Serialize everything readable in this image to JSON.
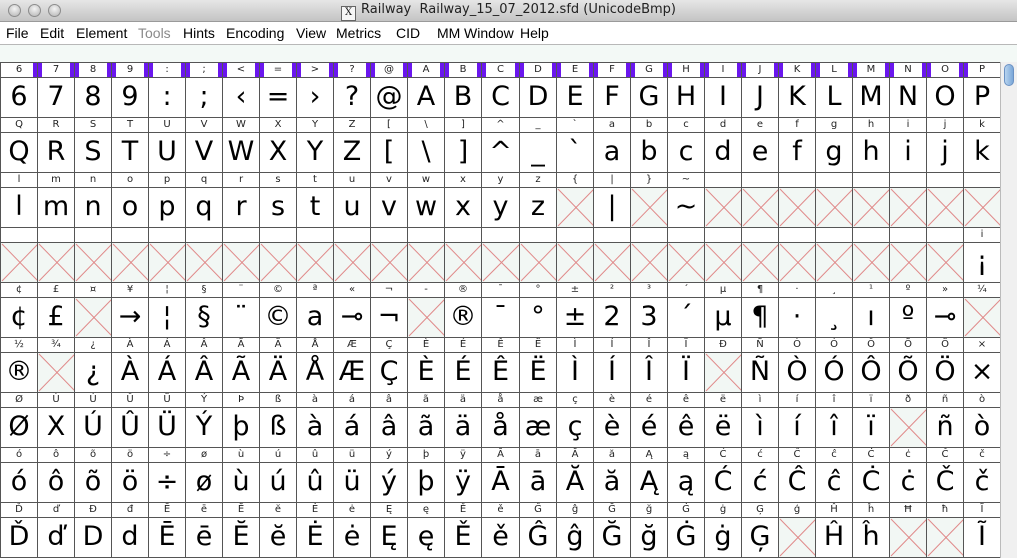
{
  "window": {
    "title_app": "Railway",
    "title_file": "Railway_15_07_2012.sfd (UnicodeBmp)",
    "x_glyph": "X"
  },
  "menu": [
    {
      "label": "File",
      "u": "F",
      "rest": "ile",
      "disabled": false
    },
    {
      "label": "Edit",
      "u": "E",
      "rest": "dit",
      "disabled": false
    },
    {
      "label": "Element",
      "u": "E",
      "rest": "lement",
      "disabled": false
    },
    {
      "label": "Tools",
      "u": "T",
      "rest": "ools",
      "disabled": true
    },
    {
      "label": "Hints",
      "u": "i",
      "pre": "H",
      "rest": "nts",
      "disabled": false
    },
    {
      "label": "Encoding",
      "u": "E",
      "rest": "ncoding",
      "disabled": false
    },
    {
      "label": "View",
      "u": "V",
      "rest": "iew",
      "disabled": false
    },
    {
      "label": "Metrics",
      "u": "M",
      "rest": "etrics",
      "disabled": false
    },
    {
      "label": "CID",
      "u": "C",
      "rest": "ID",
      "disabled": false
    },
    {
      "label": "MM",
      "u": "",
      "rest": "MM",
      "disabled": false
    },
    {
      "label": "Window",
      "u": "W",
      "rest": "indow",
      "disabled": false
    },
    {
      "label": "Help",
      "u": "H",
      "rest": "elp",
      "disabled": false
    }
  ],
  "colors": {
    "selected": "#6a16ee",
    "empty_cross": "#e08a8a",
    "cell_border": "#555555",
    "background": "#f3f9f6"
  },
  "grid": {
    "columns": 27,
    "rows": [
      {
        "labels": [
          "6",
          "7",
          "8",
          "9",
          ":",
          ";",
          "<",
          "=",
          ">",
          "?",
          "@",
          "A",
          "B",
          "C",
          "D",
          "E",
          "F",
          "G",
          "H",
          "I",
          "J",
          "K",
          "L",
          "M",
          "N",
          "O",
          "P"
        ],
        "glyphs": [
          "6",
          "7",
          "8",
          "9",
          ":",
          ";",
          "‹",
          "=",
          "›",
          "?",
          "@",
          "A",
          "B",
          "C",
          "D",
          "E",
          "F",
          "G",
          "H",
          "I",
          "J",
          "K",
          "L",
          "M",
          "N",
          "O",
          "P"
        ]
      },
      {
        "labels": [
          "Q",
          "R",
          "S",
          "T",
          "U",
          "V",
          "W",
          "X",
          "Y",
          "Z",
          "[",
          "\\",
          "]",
          "^",
          "_",
          "`",
          "a",
          "b",
          "c",
          "d",
          "e",
          "f",
          "g",
          "h",
          "i",
          "j",
          "k"
        ],
        "glyphs": [
          "Q",
          "R",
          "S",
          "T",
          "U",
          "V",
          "W",
          "X",
          "Y",
          "Z",
          "[",
          "\\",
          "]",
          "^",
          "_",
          "`",
          "a",
          "b",
          "c",
          "d",
          "e",
          "f",
          "g",
          "h",
          "i",
          "j",
          "k"
        ]
      },
      {
        "labels": [
          "l",
          "m",
          "n",
          "o",
          "p",
          "q",
          "r",
          "s",
          "t",
          "u",
          "v",
          "w",
          "x",
          "y",
          "z",
          "{",
          "|",
          "}",
          "~",
          "\u0000",
          "",
          "",
          "",
          "",
          "",
          "",
          ""
        ],
        "glyphs": [
          "l",
          "m",
          "n",
          "o",
          "p",
          "q",
          "r",
          "s",
          "t",
          "u",
          "v",
          "w",
          "x",
          "y",
          "z",
          "",
          "|",
          "",
          "~",
          "",
          "",
          "",
          "",
          "",
          "",
          "",
          ""
        ]
      },
      {
        "labels": [
          "",
          "",
          "",
          "",
          "",
          "",
          "",
          "",
          "",
          "",
          "",
          "",
          "",
          "",
          "",
          "",
          "",
          "",
          "",
          "",
          "",
          "",
          "",
          "",
          "",
          "",
          "i"
        ],
        "glyphs": [
          "",
          "",
          "",
          "",
          "",
          "",
          "",
          "",
          "",
          "",
          "",
          "",
          "",
          "",
          "",
          "",
          "",
          "",
          "",
          "",
          "",
          "",
          "",
          "",
          "",
          "",
          "¡"
        ]
      },
      {
        "labels": [
          "¢",
          "£",
          "¤",
          "¥",
          "¦",
          "§",
          "¨",
          "©",
          "ª",
          "«",
          "¬",
          "-",
          "®",
          "¯",
          "°",
          "±",
          "²",
          "³",
          "´",
          "µ",
          "¶",
          "·",
          "¸",
          "¹",
          "º",
          "»",
          "¼"
        ],
        "glyphs": [
          "¢",
          "£",
          "",
          "→",
          "¦",
          "§",
          "¨",
          "©",
          "a",
          "⊸",
          "¬",
          "",
          "®",
          "¯",
          "°",
          "±",
          "2",
          "3",
          "´",
          "µ",
          "¶",
          "·",
          "¸",
          "ı",
          "º",
          "⊸",
          ""
        ]
      },
      {
        "labels": [
          "½",
          "¾",
          "¿",
          "À",
          "Á",
          "Â",
          "Ã",
          "Ä",
          "Å",
          "Æ",
          "Ç",
          "È",
          "É",
          "Ê",
          "Ë",
          "Ì",
          "Í",
          "Î",
          "Ï",
          "Ð",
          "Ñ",
          "Ò",
          "Ó",
          "Ô",
          "Õ",
          "Ö",
          "×"
        ],
        "glyphs": [
          "®",
          "",
          "¿",
          "À",
          "Á",
          "Â",
          "Ã",
          "Ä",
          "Å",
          "Æ",
          "Ç",
          "È",
          "É",
          "Ê",
          "Ë",
          "Ì",
          "Í",
          "Î",
          "Ï",
          "",
          "Ñ",
          "Ò",
          "Ó",
          "Ô",
          "Õ",
          "Ö",
          "×"
        ]
      },
      {
        "labels": [
          "Ø",
          "Ù",
          "Ú",
          "Û",
          "Ü",
          "Ý",
          "Þ",
          "ß",
          "à",
          "á",
          "â",
          "ã",
          "ä",
          "å",
          "æ",
          "ç",
          "è",
          "é",
          "ê",
          "ë",
          "ì",
          "í",
          "î",
          "ï",
          "ð",
          "ñ",
          "ò"
        ],
        "glyphs": [
          "Ø",
          "X",
          "Ú",
          "Û",
          "Ü",
          "Ý",
          "þ",
          "ß",
          "à",
          "á",
          "â",
          "ã",
          "ä",
          "å",
          "æ",
          "ç",
          "è",
          "é",
          "ê",
          "ë",
          "ì",
          "í",
          "î",
          "ï",
          "",
          "ñ",
          "ò"
        ]
      },
      {
        "labels": [
          "ó",
          "ô",
          "õ",
          "ö",
          "÷",
          "ø",
          "ù",
          "ú",
          "û",
          "ü",
          "ý",
          "þ",
          "ÿ",
          "Ā",
          "ā",
          "Ă",
          "ă",
          "Ą",
          "ą",
          "Ć",
          "ć",
          "Ĉ",
          "ĉ",
          "Ċ",
          "ċ",
          "Č",
          "č"
        ],
        "glyphs": [
          "ó",
          "ô",
          "õ",
          "ö",
          "÷",
          "ø",
          "ù",
          "ú",
          "û",
          "ü",
          "ý",
          "þ",
          "ÿ",
          "Ā",
          "ā",
          "Ă",
          "ă",
          "Ą",
          "ą",
          "Ć",
          "ć",
          "Ĉ",
          "ĉ",
          "Ċ",
          "ċ",
          "Č",
          "č"
        ]
      },
      {
        "labels": [
          "Ď",
          "ď",
          "Đ",
          "đ",
          "Ē",
          "ē",
          "Ĕ",
          "ĕ",
          "Ė",
          "ė",
          "Ę",
          "ę",
          "Ě",
          "ě",
          "Ĝ",
          "ĝ",
          "Ğ",
          "ğ",
          "Ġ",
          "ġ",
          "Ģ",
          "ģ",
          "Ĥ",
          "ĥ",
          "Ħ",
          "ħ",
          "Ĩ"
        ],
        "glyphs": [
          "Ď",
          "ď",
          "D",
          "d",
          "Ē",
          "ē",
          "Ĕ",
          "ĕ",
          "Ė",
          "ė",
          "Ę",
          "ę",
          "Ě",
          "ě",
          "Ĝ",
          "ĝ",
          "Ğ",
          "ğ",
          "Ġ",
          "ġ",
          "Ģ",
          "",
          "Ĥ",
          "ĥ",
          "",
          "",
          "Ĩ"
        ]
      }
    ],
    "selected_label_cells": [
      [
        0,
        0,
        "sel-r"
      ],
      [
        0,
        1,
        "sel-lr"
      ],
      [
        0,
        2,
        "sel-lr"
      ],
      [
        0,
        3,
        "sel-lr"
      ],
      [
        0,
        4,
        "sel-lr"
      ],
      [
        0,
        5,
        "sel-lr"
      ],
      [
        0,
        6,
        "sel-lr"
      ],
      [
        0,
        7,
        "sel-lr"
      ],
      [
        0,
        8,
        "sel-lr"
      ],
      [
        0,
        9,
        "sel-lr"
      ],
      [
        0,
        10,
        "sel-lr"
      ],
      [
        0,
        11,
        "sel-lr"
      ],
      [
        0,
        12,
        "sel-lr"
      ],
      [
        0,
        13,
        "sel-lr"
      ],
      [
        0,
        14,
        "sel-lr"
      ],
      [
        0,
        15,
        "sel-lr"
      ],
      [
        0,
        16,
        "sel-lr"
      ],
      [
        0,
        17,
        "sel-lr"
      ],
      [
        0,
        18,
        "sel-lr"
      ],
      [
        0,
        19,
        "sel-lr"
      ],
      [
        0,
        20,
        "sel-lr"
      ],
      [
        0,
        21,
        "sel-lr"
      ],
      [
        0,
        22,
        "sel-lr"
      ],
      [
        0,
        23,
        "sel-lr"
      ],
      [
        0,
        24,
        "sel-lr"
      ],
      [
        0,
        25,
        "sel-lr"
      ],
      [
        0,
        26,
        "sel-l"
      ]
    ]
  }
}
